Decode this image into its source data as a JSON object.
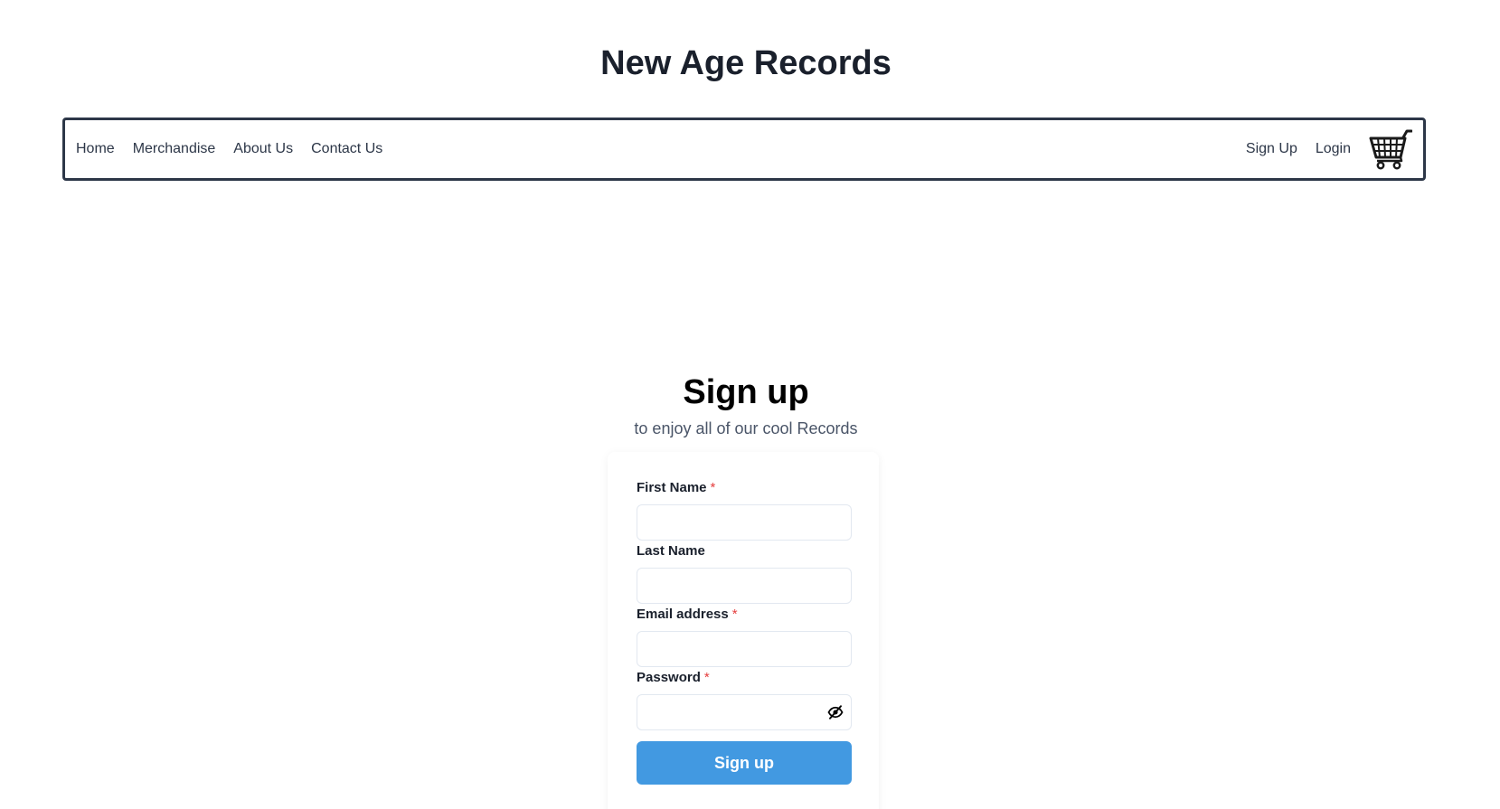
{
  "site": {
    "title": "New Age Records"
  },
  "nav": {
    "left": [
      {
        "label": "Home"
      },
      {
        "label": "Merchandise"
      },
      {
        "label": "About Us"
      },
      {
        "label": "Contact Us"
      }
    ],
    "right": [
      {
        "label": "Sign Up"
      },
      {
        "label": "Login"
      }
    ],
    "cart_icon": "shopping-cart-icon"
  },
  "signup": {
    "heading": "Sign up",
    "subheading": "to enjoy all of our cool Records",
    "fields": {
      "first_name": {
        "label": "First Name",
        "required": "*",
        "value": ""
      },
      "last_name": {
        "label": "Last Name",
        "value": ""
      },
      "email": {
        "label": "Email address",
        "required": "*",
        "value": ""
      },
      "password": {
        "label": "Password",
        "required": "*",
        "value": "",
        "toggle_icon": "eye-slash-icon"
      }
    },
    "submit_label": "Sign up",
    "colors": {
      "button_bg": "#4299e1",
      "required_mark": "#e53e3e",
      "nav_border": "#2d3748"
    }
  }
}
